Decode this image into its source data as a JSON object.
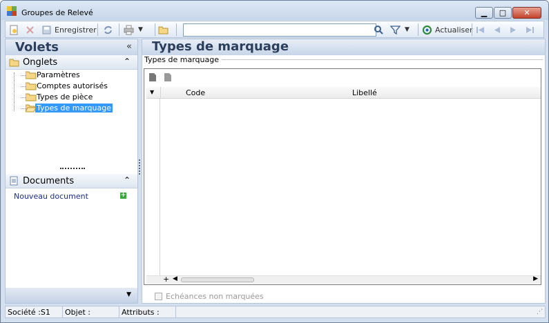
{
  "window": {
    "title": "Groupes de Relevé",
    "minimize": "▁",
    "maximize": "□",
    "close": "✕"
  },
  "toolbar": {
    "save_label": "Enregistrer",
    "search_value": "",
    "refresh_label": "Actualiser"
  },
  "left_panel": {
    "title": "Volets",
    "collapse_icon": "«",
    "onglets": {
      "label": "Onglets",
      "items": [
        {
          "label": "Paramètres"
        },
        {
          "label": "Comptes autorisés"
        },
        {
          "label": "Types de pièce"
        },
        {
          "label": "Types de marquage",
          "selected": true
        }
      ]
    },
    "documents": {
      "label": "Documents",
      "new_doc": "Nouveau document"
    }
  },
  "main": {
    "title": "Types de marquage",
    "group_label": "Types de marquage",
    "columns": [
      "Code",
      "Libellé"
    ],
    "checkbox_label": "Echéances non marquées"
  },
  "statusbar": {
    "societe": "Société :S1",
    "objet": "Objet :",
    "attributs": "Attributs :"
  },
  "colors": {
    "accent": "#3399ff",
    "panel_head": "#c7d5e8",
    "title_text": "#2b3f5c"
  }
}
